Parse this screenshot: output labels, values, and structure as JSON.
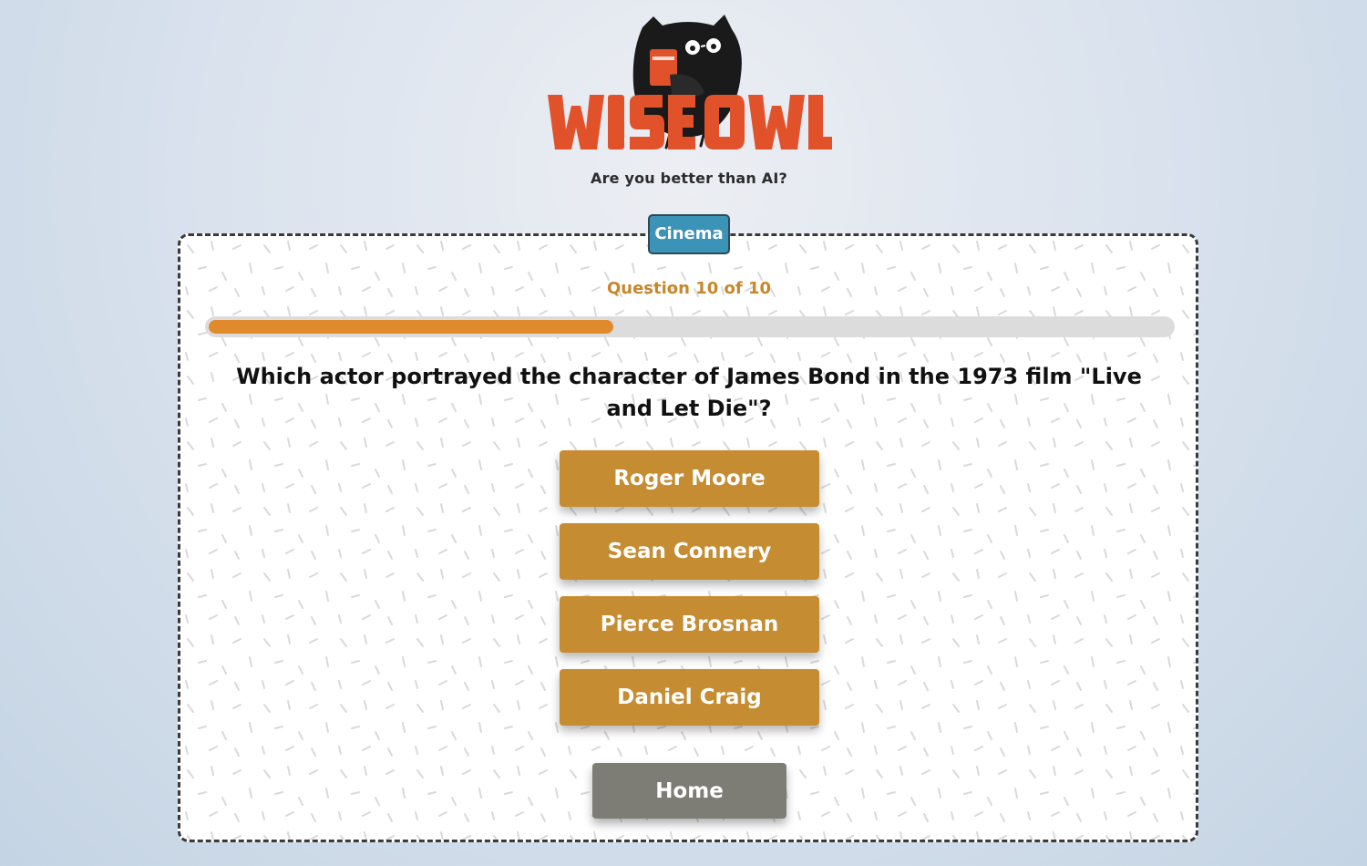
{
  "brand": {
    "logo_text": "WISE OWL",
    "tagline": "Are you better than AI?",
    "colors": {
      "logo_red": "#e1522b",
      "owl_black": "#1a1a1a"
    }
  },
  "quiz": {
    "category": "Cinema",
    "counter": "Question 10 of 10",
    "progress_fraction": 0.4,
    "question": "Which actor portrayed the character of James Bond in the 1973 film \"Live and Let Die\"?",
    "answers": [
      "Roger Moore",
      "Sean Connery",
      "Pierce Brosnan",
      "Daniel Craig"
    ],
    "home_label": "Home"
  },
  "colors": {
    "category_badge": "#3b93b8",
    "counter_text": "#c7872c",
    "progress_fill": "#e18a2c",
    "progress_track": "#dcdcdc",
    "answer_button": "#c68c31",
    "home_button": "#7d7d75"
  },
  "icons": {
    "logo": "wise-owl-logo-icon"
  }
}
